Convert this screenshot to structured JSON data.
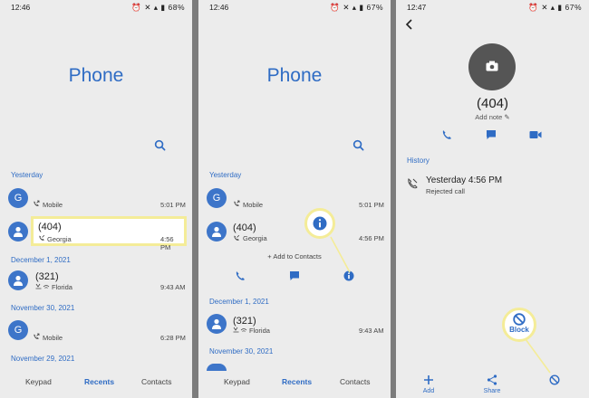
{
  "screen1": {
    "status": {
      "time": "12:46",
      "battery": "68%"
    },
    "title": "Phone",
    "sections": {
      "yesterday": "Yesterday",
      "dec1": "December 1, 2021",
      "nov30": "November 30, 2021",
      "nov29": "November 29, 2021"
    },
    "calls": [
      {
        "initial": "G",
        "name": "",
        "sub": "Mobile",
        "time": "5:01 PM"
      },
      {
        "initial": "",
        "name": "(404)",
        "sub": "Georgia",
        "time": "4:56 PM"
      },
      {
        "initial": "",
        "name": "(321)",
        "sub": "Florida",
        "time": "9:43 AM"
      },
      {
        "initial": "G",
        "name": "",
        "sub": "Mobile",
        "time": "6:28 PM"
      }
    ],
    "tabs": {
      "keypad": "Keypad",
      "recents": "Recents",
      "contacts": "Contacts"
    }
  },
  "screen2": {
    "status": {
      "time": "12:46",
      "battery": "67%"
    },
    "title": "Phone",
    "sections": {
      "yesterday": "Yesterday",
      "dec1": "December 1, 2021",
      "nov30": "November 30, 2021"
    },
    "calls": [
      {
        "initial": "G",
        "name": "",
        "sub": "Mobile",
        "time": "5:01 PM"
      },
      {
        "initial": "",
        "name": "(404)",
        "sub": "Georgia",
        "time": "4:56 PM"
      },
      {
        "initial": "",
        "name": "(321)",
        "sub": "Florida",
        "time": "9:43 AM"
      }
    ],
    "add_to_contacts": "+ Add to Contacts",
    "tabs": {
      "keypad": "Keypad",
      "recents": "Recents",
      "contacts": "Contacts"
    }
  },
  "screen3": {
    "status": {
      "time": "12:47",
      "battery": "67%"
    },
    "contact_name": "(404)",
    "add_note": "Add note",
    "history_label": "History",
    "history_time": "Yesterday 4:56 PM",
    "history_sub": "Rejected call",
    "block_label": "Block",
    "bottom": {
      "add": "Add",
      "share": "Share"
    }
  },
  "colors": {
    "accent": "#2f6cc4",
    "highlight": "#f4ec98",
    "panel_bg": "#ececec"
  }
}
